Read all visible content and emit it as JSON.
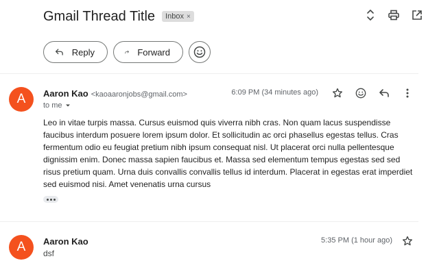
{
  "thread": {
    "subject": "Gmail Thread Title",
    "label": "Inbox",
    "label_remove": "×"
  },
  "top_icons": [
    "expand-collapse-icon",
    "print-icon",
    "open-in-new-window-icon"
  ],
  "actions": {
    "reply_label": "Reply",
    "forward_label": "Forward"
  },
  "messages": [
    {
      "avatar_letter": "A",
      "sender_name": "Aaron Kao",
      "sender_email": "<kaoaaronjobs@gmail.com>",
      "recipient": "to me",
      "time": "6:09 PM (34 minutes ago)",
      "body": "Leo in vitae turpis massa. Cursus euismod quis viverra nibh cras. Non quam lacus suspendisse faucibus interdum posuere lorem ipsum dolor. Et sollicitudin ac orci phasellus egestas tellus. Cras fermentum odio eu feugiat pretium nibh ipsum consequat nisl. Ut placerat orci nulla pellentesque dignissim enim. Donec massa sapien faucibus et. Massa sed elementum tempus egestas sed sed risus pretium quam. Urna duis convallis convallis tellus id interdum. Placerat in egestas erat imperdiet sed euismod nisi. Amet venenatis urna cursus"
    },
    {
      "avatar_letter": "A",
      "sender_name": "Aaron Kao",
      "time": "5:35 PM (1 hour ago)",
      "snippet": "dsf"
    }
  ],
  "colors": {
    "avatar": "#f4511e",
    "text": "#1f1f1f",
    "muted": "#5f6368",
    "label_chip": "#dddddd"
  }
}
